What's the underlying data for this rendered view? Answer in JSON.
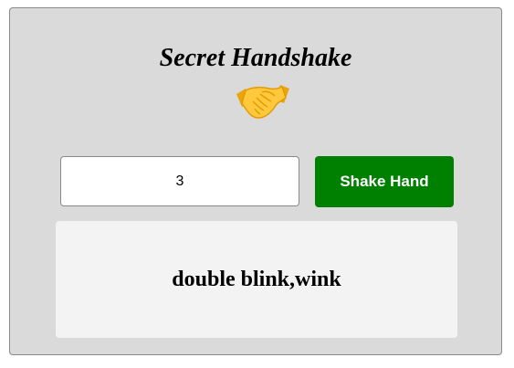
{
  "app": {
    "title": "Secret Handshake",
    "emoji_icon": "handshake-icon"
  },
  "form": {
    "number_value": "3",
    "button_label": "Shake Hand"
  },
  "result": {
    "text": "double blink,wink"
  },
  "colors": {
    "card_background": "#dadada",
    "button": "#008000",
    "result_background": "#f3f3f3"
  }
}
